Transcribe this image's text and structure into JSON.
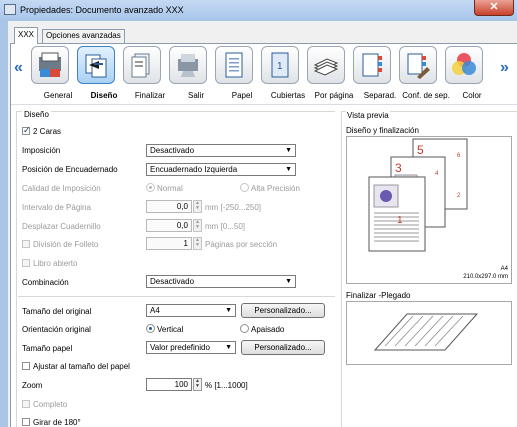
{
  "window": {
    "title": "Propiedades: Documento avanzado XXX",
    "close_label": "✕"
  },
  "tabs": [
    {
      "label": "XXX"
    },
    {
      "label": "Opciones avanzadas"
    }
  ],
  "iconbar": {
    "left_arrow": "«",
    "right_arrow": "»",
    "items": [
      {
        "label": "General",
        "icon": "general-icon"
      },
      {
        "label": "Diseño",
        "icon": "layout-icon",
        "selected": true
      },
      {
        "label": "Finalizar",
        "icon": "finishing-icon"
      },
      {
        "label": "Salir",
        "icon": "output-icon"
      },
      {
        "label": "Papel",
        "icon": "paper-icon"
      },
      {
        "label": "Cubiertas",
        "icon": "covers-icon"
      },
      {
        "label": "Por página",
        "icon": "per-page-icon"
      },
      {
        "label": "Separad.",
        "icon": "separator-icon"
      },
      {
        "label": "Conf. de sep.",
        "icon": "separator-settings-icon"
      },
      {
        "label": "Color",
        "icon": "color-icon"
      }
    ]
  },
  "layout": {
    "section_title": "Diseño",
    "two_sided": {
      "label": "2 Caras",
      "checked": true
    },
    "imposition": {
      "label": "Imposición",
      "value": "Desactivado"
    },
    "binding_position": {
      "label": "Posición de Encuadernado",
      "value": "Encuadernado Izquierda"
    },
    "imposition_quality": {
      "label": "Calidad de Imposición",
      "option_normal": "Normal",
      "option_high": "Alta Precisión"
    },
    "page_spacing": {
      "label": "Intervalo de Página",
      "value": "0,0",
      "unit": "mm [-250...250]"
    },
    "booklet_shift": {
      "label": "Desplazar Cuadernillo",
      "value": "0,0",
      "unit": "mm [0...50]"
    },
    "booklet_split": {
      "label": "División de Folleto",
      "value": "1",
      "unit": "Páginas por sección"
    },
    "open_book": {
      "label": "Libro abierto"
    },
    "combination": {
      "label": "Combinación",
      "value": "Desactivado"
    },
    "original_size": {
      "label": "Tamaño del original",
      "value": "A4",
      "button": "Personalizado..."
    },
    "original_orientation": {
      "label": "Orientación original",
      "option_portrait": "Vertical",
      "option_landscape": "Apaisado"
    },
    "paper_size": {
      "label": "Tamaño papel",
      "value": "Valor predefinido",
      "button": "Personalizado..."
    },
    "fit_to_paper": {
      "label": "Ajustar al tamaño del papel"
    },
    "zoom": {
      "label": "Zoom",
      "value": "100",
      "unit": "% [1...1000]"
    },
    "full_bleed": {
      "label": "Completo"
    },
    "rotate_180": {
      "label": "Girar de 180°"
    }
  },
  "preview": {
    "section_title": "Vista previa",
    "layout_title": "Diseño y finalización",
    "page_numbers": [
      "5",
      "3",
      "1"
    ],
    "page_small_numbers": [
      "6",
      "4",
      "2"
    ],
    "paper_name": "A4",
    "paper_dims": "210.0x297.0 mm",
    "fold_title": "Finalizar -Plegado"
  }
}
